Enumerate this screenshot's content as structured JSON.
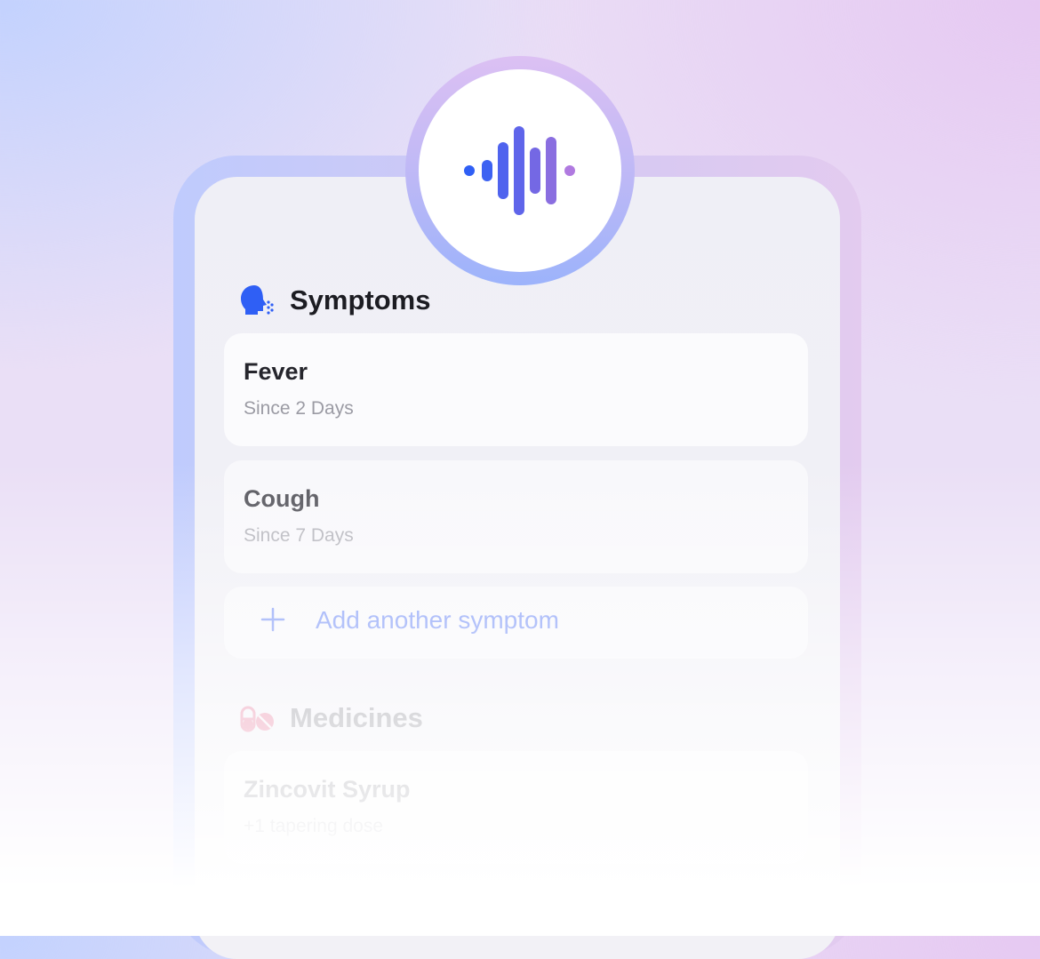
{
  "symptoms": {
    "title": "Symptoms",
    "items": [
      {
        "name": "Fever",
        "duration": "Since 2 Days"
      },
      {
        "name": "Cough",
        "duration": "Since 7 Days"
      }
    ],
    "add_label": "Add another symptom"
  },
  "medicines": {
    "title": "Medicines",
    "items": [
      {
        "name": "Zincovit Syrup",
        "detail": "+1 tapering dose"
      }
    ]
  },
  "icons": {
    "voice": "voice-waveform-icon",
    "symptoms": "speaking-head-icon",
    "medicines": "pills-icon",
    "add": "plus-icon"
  },
  "colors": {
    "accent_blue": "#2f5ff5",
    "accent_purple": "#b07ae0",
    "add_text": "#7f98f7",
    "medicine_icon": "#e98aa8"
  }
}
